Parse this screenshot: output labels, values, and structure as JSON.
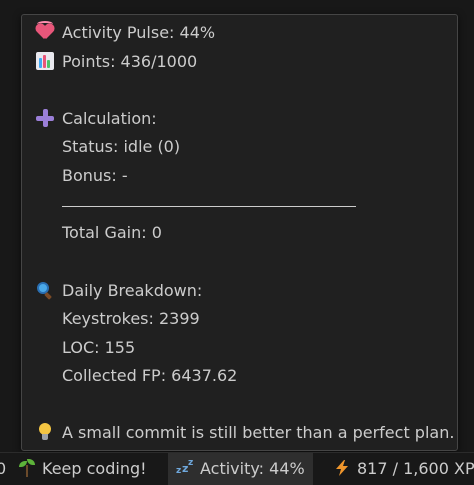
{
  "tooltip": {
    "activity_pulse": "Activity Pulse: 44%",
    "points": "Points: 436/1000",
    "calculation": {
      "heading": "Calculation:",
      "status": "Status: idle (0)",
      "bonus": "Bonus: -",
      "total_gain": "Total Gain: 0"
    },
    "daily_breakdown": {
      "heading": "Daily Breakdown:",
      "keystrokes": "Keystrokes: 2399",
      "loc": "LOC: 155",
      "collected_fp": "Collected FP: 6437.62"
    },
    "tip": "A small commit is still better than a perfect plan."
  },
  "statusbar": {
    "leading_fragment": "0",
    "keep_coding": "Keep coding!",
    "activity": "Activity: 44%",
    "xp": "817 / 1,600 XP"
  },
  "icons": {
    "pulse": "heart-with-pulse-icon",
    "points": "bar-chart-icon",
    "calculation": "plus-icon",
    "breakdown": "magnifier-icon",
    "tip": "light-bulb-icon",
    "keep_coding": "seedling-icon",
    "activity": "sleeping-zzz-icon",
    "xp": "lightning-bolt-icon"
  },
  "colors": {
    "background": "#181818",
    "tooltip_bg": "#202020",
    "tooltip_border": "#454545",
    "text": "#cccccc",
    "active_item_bg": "#2e2e2e"
  }
}
